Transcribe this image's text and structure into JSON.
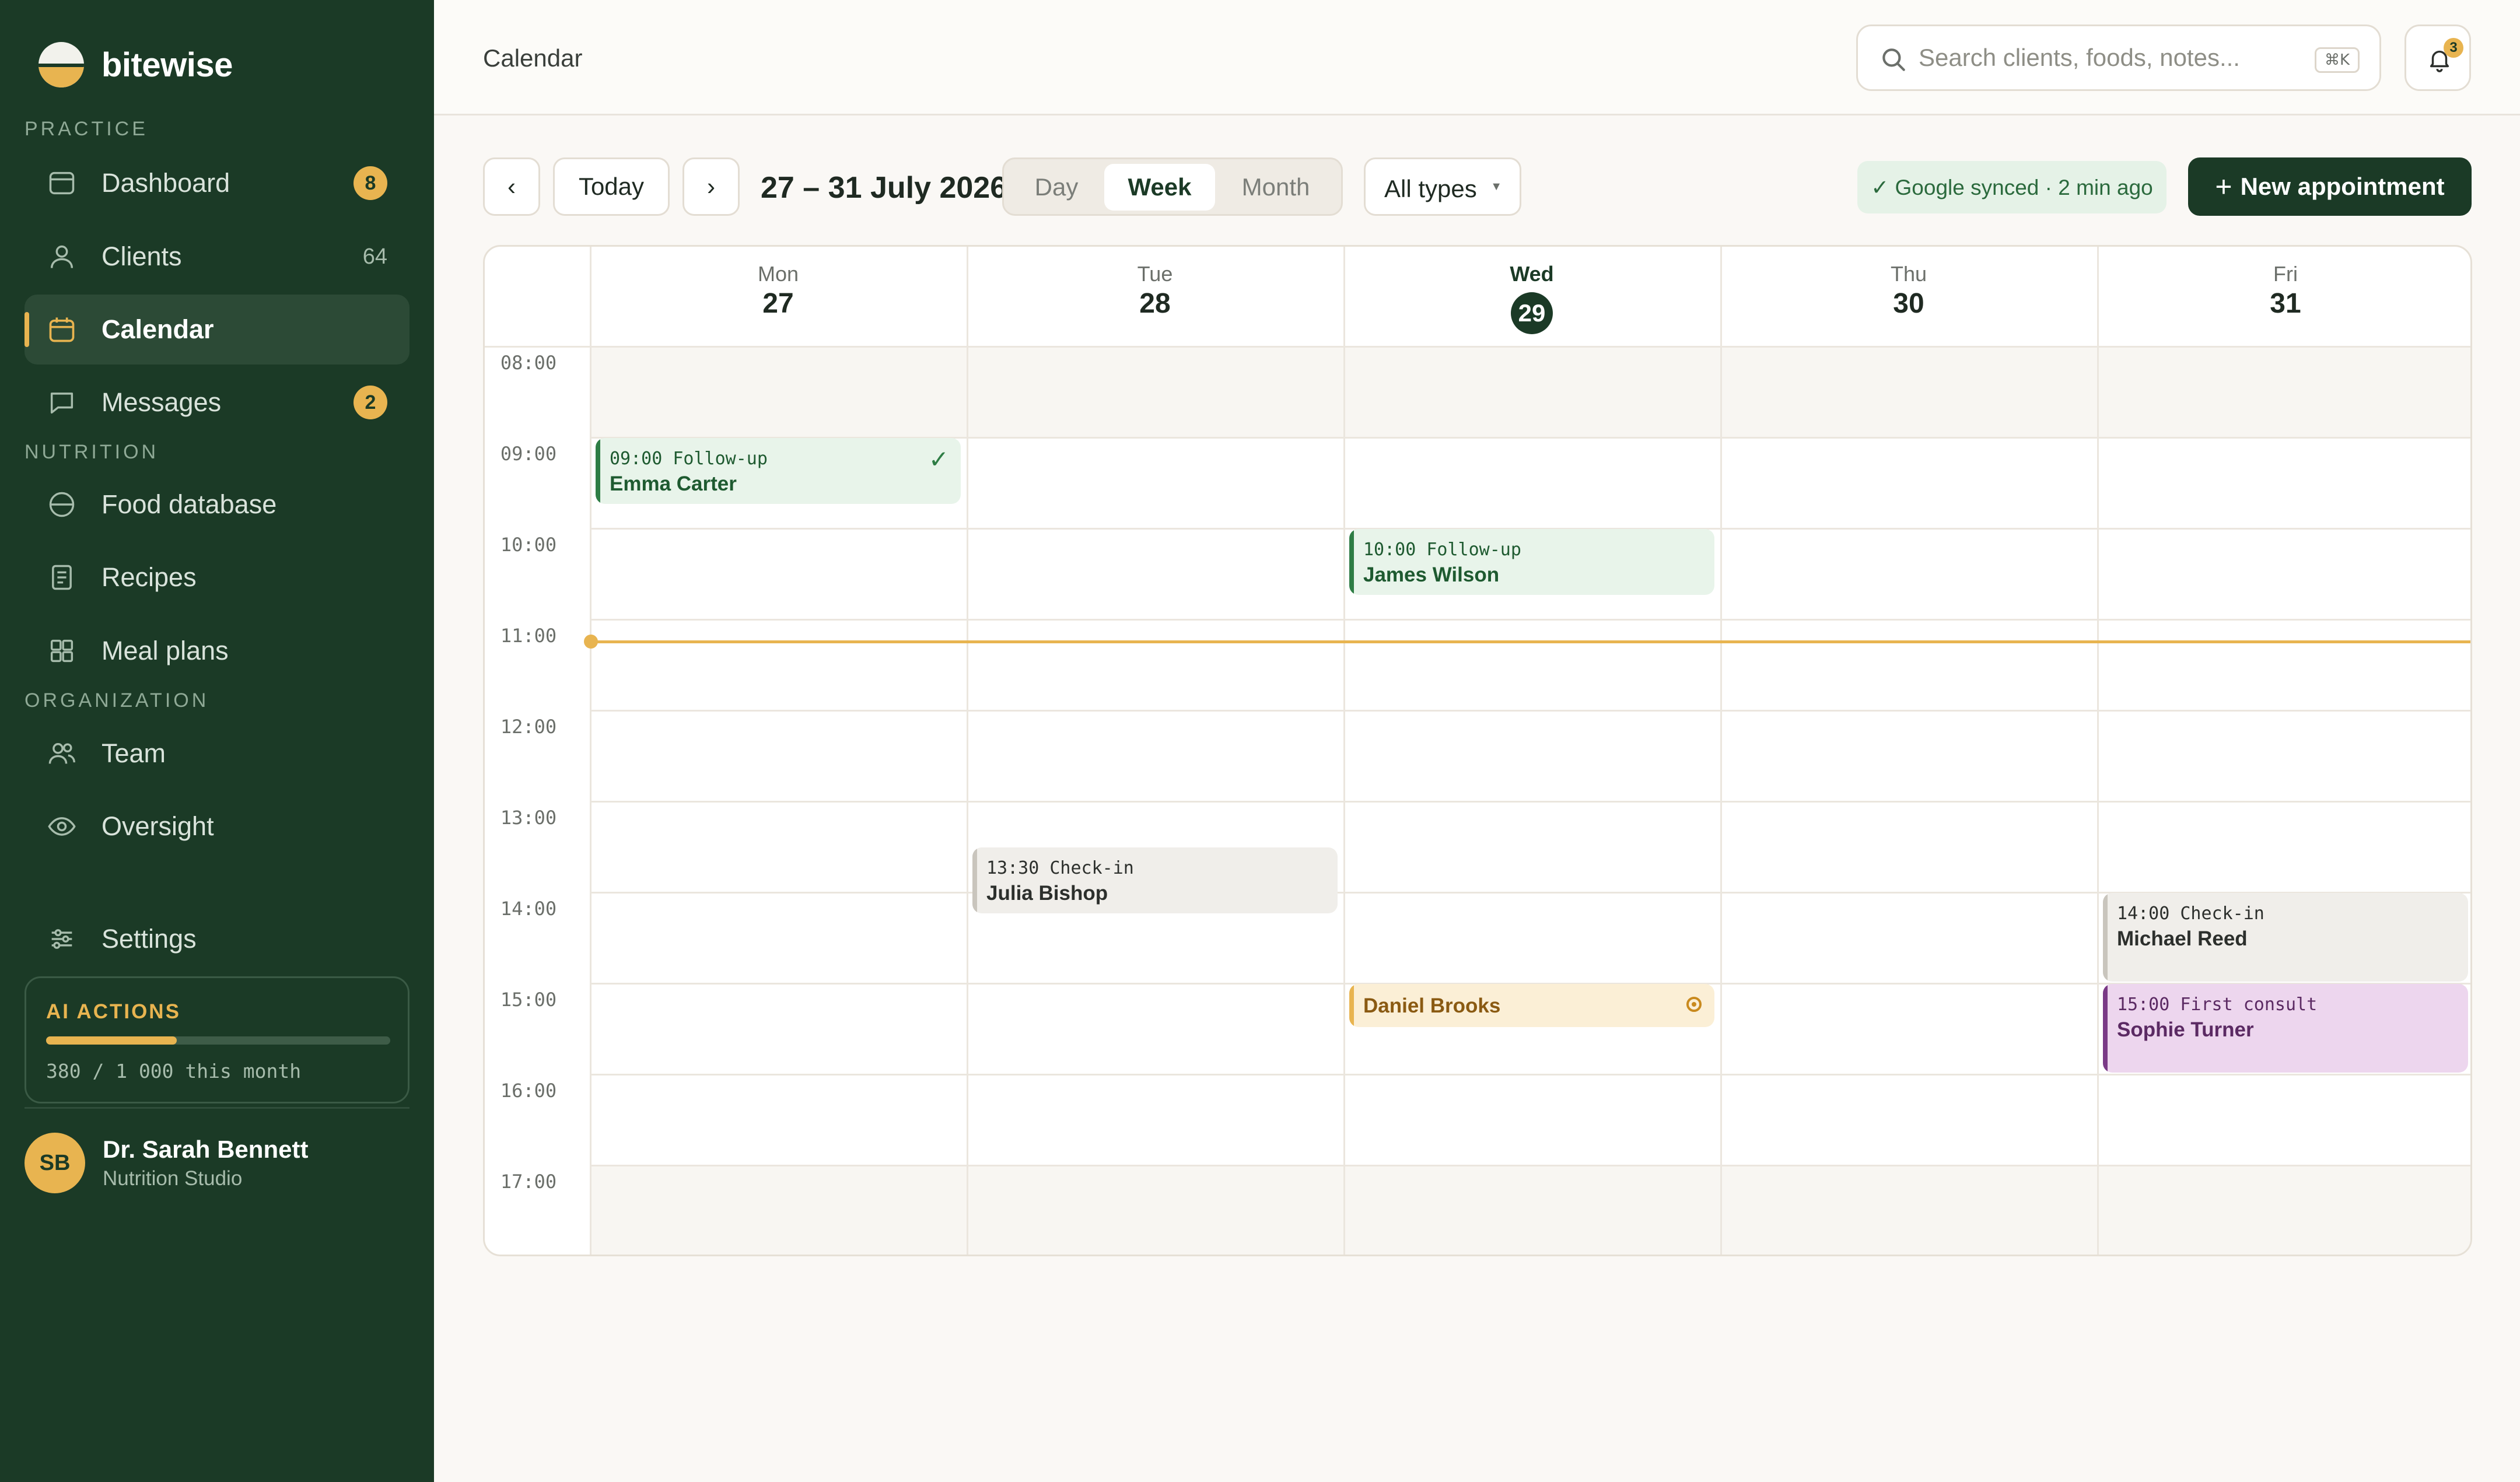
{
  "brand": {
    "name": "bitewise"
  },
  "sidebar": {
    "sections": [
      {
        "label": "PRACTICE"
      },
      {
        "label": "NUTRITION"
      },
      {
        "label": "ORGANIZATION"
      }
    ],
    "items": [
      {
        "label": "Dashboard",
        "badge": "8",
        "icon": "dashboard-icon"
      },
      {
        "label": "Clients",
        "count": "64",
        "icon": "user-icon"
      },
      {
        "label": "Calendar",
        "icon": "calendar-icon",
        "active": true
      },
      {
        "label": "Messages",
        "badge": "2",
        "icon": "message-icon"
      },
      {
        "label": "Food database",
        "icon": "food-icon"
      },
      {
        "label": "Recipes",
        "icon": "recipe-icon"
      },
      {
        "label": "Meal plans",
        "icon": "grid-icon"
      },
      {
        "label": "Team",
        "icon": "team-icon"
      },
      {
        "label": "Oversight",
        "icon": "eye-icon"
      },
      {
        "label": "Settings",
        "icon": "sliders-icon"
      }
    ],
    "ai": {
      "title": "AI ACTIONS",
      "usage": "380 / 1 000 this month",
      "used": 380,
      "limit": 1000
    },
    "user": {
      "initials": "SB",
      "name": "Dr. Sarah Bennett",
      "org": "Nutrition Studio"
    }
  },
  "topbar": {
    "title": "Calendar",
    "search_placeholder": "Search clients, foods, notes...",
    "shortcut": "⌘K",
    "notifications": "3"
  },
  "toolbar": {
    "prev": "‹",
    "today": "Today",
    "next": "›",
    "range": "27 – 31 July 2026",
    "views": [
      "Day",
      "Week",
      "Month"
    ],
    "active_view": "Week",
    "filter": "All types",
    "sync_status": "✓ Google synced · 2 min ago",
    "new_appointment": "New appointment",
    "colors": {
      "brand": "#1b3a26",
      "accent": "#e8b450"
    }
  },
  "calendar": {
    "days": [
      {
        "name": "Mon",
        "num": "27"
      },
      {
        "name": "Tue",
        "num": "28"
      },
      {
        "name": "Wed",
        "num": "29",
        "today": true
      },
      {
        "name": "Thu",
        "num": "30"
      },
      {
        "name": "Fri",
        "num": "31"
      }
    ],
    "hours": [
      "08:00",
      "09:00",
      "10:00",
      "11:00",
      "12:00",
      "13:00",
      "14:00",
      "15:00",
      "16:00",
      "17:00"
    ],
    "now": "11:15",
    "events": [
      {
        "day": 0,
        "start": "09:00",
        "end": "09:45",
        "time_label": "09:00 Follow-up",
        "client": "Emma Carter",
        "style": "green",
        "confirmed": true
      },
      {
        "day": 2,
        "start": "10:00",
        "end": "10:45",
        "time_label": "10:00 Follow-up",
        "client": "James Wilson",
        "style": "green"
      },
      {
        "day": 1,
        "start": "13:30",
        "end": "14:15",
        "time_label": "13:30 Check-in",
        "client": "Julia Bishop",
        "style": "gray"
      },
      {
        "day": 4,
        "start": "14:00",
        "end": "15:00",
        "time_label": "14:00 Check-in",
        "client": "Michael Reed",
        "style": "gray"
      },
      {
        "day": 2,
        "start": "15:00",
        "end": "15:30",
        "time_label": "",
        "client": "Daniel Brooks",
        "style": "amber",
        "pending": true
      },
      {
        "day": 4,
        "start": "15:00",
        "end": "16:00",
        "time_label": "15:00 First consult",
        "client": "Sophie Turner",
        "style": "purple"
      }
    ]
  }
}
